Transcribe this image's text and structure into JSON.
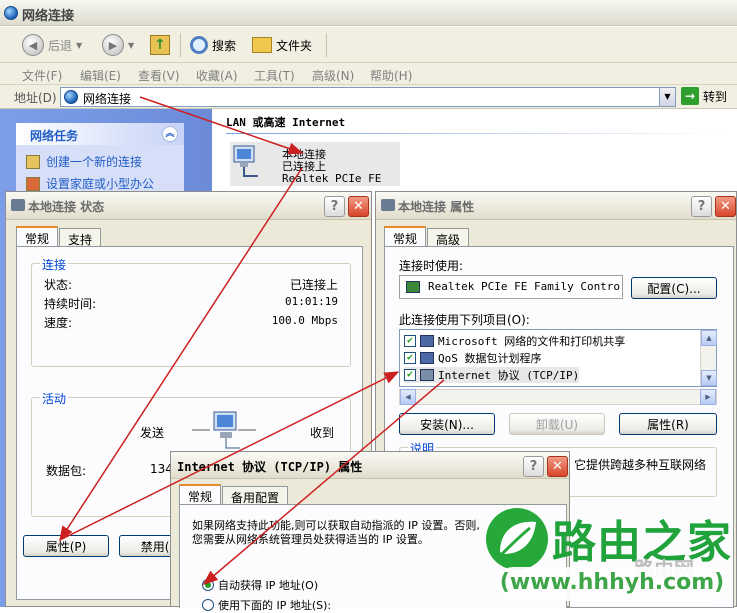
{
  "explorer": {
    "title": "网络连接",
    "toolbar": {
      "back": "后退",
      "search": "搜索",
      "folders": "文件夹"
    },
    "menu": [
      "文件(F)",
      "编辑(E)",
      "查看(V)",
      "收藏(A)",
      "工具(T)",
      "高级(N)",
      "帮助(H)"
    ],
    "address": {
      "label": "地址(D)",
      "value": "网络连接",
      "go": "转到"
    },
    "tasks": {
      "header": "网络任务",
      "items": [
        "创建一个新的连接",
        "设置家庭或小型办公"
      ]
    },
    "content": {
      "section": "LAN 或高速 Internet",
      "item": {
        "name": "本地连接",
        "status": "已连接上",
        "device": "Realtek PCIe FE ..."
      }
    }
  },
  "status_dialog": {
    "title": "本地连接 状态",
    "tabs": [
      "常规",
      "支持"
    ],
    "connection": {
      "label": "连接",
      "rows": [
        {
          "k": "状态:",
          "v": "已连接上"
        },
        {
          "k": "持续时间:",
          "v": "01:01:19"
        },
        {
          "k": "速度:",
          "v": "100.0 Mbps"
        }
      ]
    },
    "activity": {
      "label": "活动",
      "sent": "发送",
      "received": "收到",
      "packets_label": "数据包:",
      "packets_sent": "134"
    },
    "buttons": {
      "properties": "属性(P)",
      "disable": "禁用(D)"
    }
  },
  "props_dialog": {
    "title": "本地连接 属性",
    "tabs": [
      "常规",
      "高级"
    ],
    "connect_using_label": "连接时使用:",
    "adapter": "Realtek PCIe FE Family Control",
    "configure": "配置(C)...",
    "items_label": "此连接使用下列项目(O):",
    "items": [
      {
        "label": "Microsoft 网络的文件和打印机共享",
        "checked": true
      },
      {
        "label": "QoS 数据包计划程序",
        "checked": true
      },
      {
        "label": "Internet 协议 (TCP/IP)",
        "checked": true
      }
    ],
    "buttons": {
      "install": "安装(N)...",
      "uninstall": "卸载(U)",
      "properties": "属性(R)"
    },
    "description_label": "说明",
    "description_text": "它提供跨越多种互联网络"
  },
  "tcpip_dialog": {
    "title": "Internet 协议 (TCP/IP) 属性",
    "tabs": [
      "常规",
      "备用配置"
    ],
    "intro_line1": "如果网络支持此功能,则可以获取自动指派的 IP 设置。否则,",
    "intro_line2": "您需要从网络系统管理员处获得适当的 IP 设置。",
    "option_auto": "自动获得 IP 地址(O)",
    "option_manual": "使用下面的 IP 地址(S):"
  },
  "watermark": {
    "name": "路由之家",
    "url": "(www.hhhyh.com)",
    "faint": "路由网"
  },
  "colors": {
    "arrow": "#cc1f1f",
    "accent": "#e68b2c",
    "group_label": "#0046d5",
    "xp_blue": "#215dc6"
  }
}
